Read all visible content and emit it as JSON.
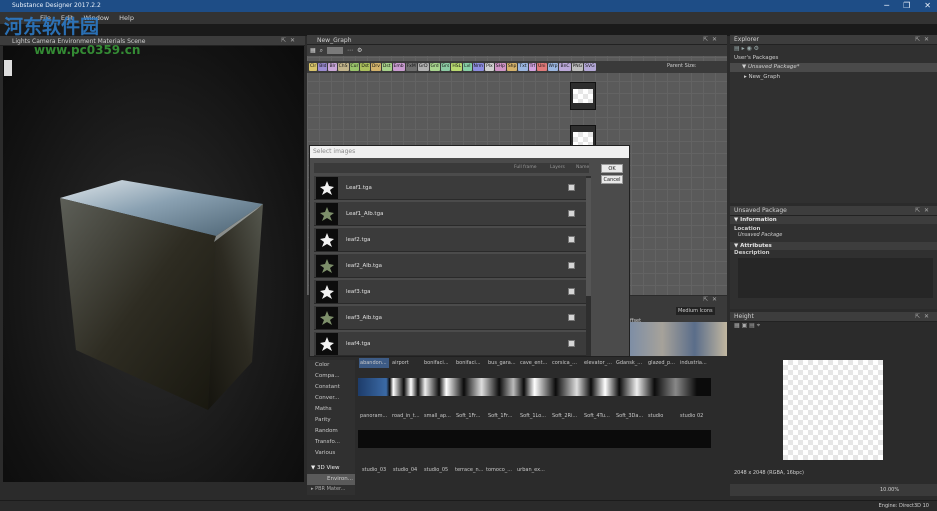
{
  "window": {
    "title": "Substance Designer 2017.2.2",
    "min": "─",
    "max": "❐",
    "close": "✕"
  },
  "menu": [
    "File",
    "Edit",
    "Window",
    "Help"
  ],
  "viewport": {
    "header": "Lights  Camera  Environment  Materials  Scene",
    "tab": "3D View"
  },
  "watermark": {
    "line1": "河东软件园",
    "line2": "www.pc0359.cn"
  },
  "graph": {
    "tab": "New_Graph",
    "parent_size": "Parent Size:",
    "tags": [
      [
        "Clr",
        "#d8c46a"
      ],
      [
        "Bld",
        "#9b8bd1"
      ],
      [
        "Blr",
        "#c9a6d8"
      ],
      [
        "ChS",
        "#c2b48a"
      ],
      [
        "Cur",
        "#99c46a"
      ],
      [
        "Dst",
        "#aabf5c"
      ],
      [
        "Drv",
        "#d2b26a"
      ],
      [
        "Dst",
        "#a6d08a"
      ],
      [
        "Emb",
        "#c99bd0"
      ],
      [
        "FxM",
        "#6f6f6f"
      ],
      [
        "GrD",
        "#b1b1b1"
      ],
      [
        "Grd",
        "#a8d48e"
      ],
      [
        "Grs",
        "#8bc9a3"
      ],
      [
        "HSL",
        "#b8d86f"
      ],
      [
        "Lvl",
        "#86cfa5"
      ],
      [
        "Nrm",
        "#8d8de0"
      ],
      [
        "Plx",
        "#cfcfcf"
      ],
      [
        "SHp",
        "#d095c6"
      ],
      [
        "Shp",
        "#d4b26a"
      ],
      [
        "Txt",
        "#9bb6e0"
      ],
      [
        "Trf",
        "#d1a2e0"
      ],
      [
        "Uni",
        "#e07a7a"
      ],
      [
        "Wrp",
        "#9bb6e0"
      ],
      [
        "BnC",
        "#bba8d8"
      ],
      [
        "PNG",
        "#bdbdbd"
      ],
      [
        "SVG",
        "#b3a7d6"
      ]
    ]
  },
  "dialog": {
    "title": "Select images",
    "filter_label": "Full frame",
    "layers_label": "Layers",
    "name_label": "Name",
    "ok": "OK",
    "cancel": "Cancel",
    "files": [
      "Leaf1.tga",
      "Leaf1_Alb.tga",
      "leaf2.tga",
      "leaf2_Alb.tga",
      "leaf3.tga",
      "leaf3_Alb.tga",
      "leaf4.tga"
    ]
  },
  "library": {
    "view_mode": "Medium Icons",
    "tree": [
      "Color",
      "Compa...",
      "Constant",
      "Conver...",
      "Maths",
      "Parity",
      "Random",
      "Transfo...",
      "Various"
    ],
    "tree_header": "3D View",
    "tree_selected": "Environ...",
    "tree_footer": "PBR Mater...",
    "row1": [
      "abandon...",
      "airport",
      "bonifaci...",
      "bonifaci...",
      "bus_gara...",
      "cave_ent...",
      "corsica_...",
      "elevator_...",
      "Gdansk_...",
      "glazed_p...",
      "industria..."
    ],
    "row2": [
      "panoram...",
      "road_in_t...",
      "small_ap...",
      "Soft_1Fr...",
      "Soft_1Fr...",
      "Soft_1Lo...",
      "Soft_2Ri...",
      "Soft_4Tu...",
      "Soft_3Da...",
      "studio",
      "studio 02"
    ],
    "row3": [
      "studio_03",
      "studio_04",
      "studio_05",
      "terrace_n...",
      "tomoco_...",
      "urban_ex..."
    ],
    "filter": "ffset"
  },
  "explorer": {
    "tab": "Explorer",
    "root": "User's Packages",
    "package": "Unsaved Package*",
    "graph": "New_Graph"
  },
  "props": {
    "tab": "Unsaved Package",
    "sec1": "Information",
    "location_label": "Location",
    "location": "Unsaved Package",
    "sec2": "Attributes",
    "description": "Description"
  },
  "height": {
    "tab": "Height",
    "info": "2048 x 2048 (RGBA, 16bpc)",
    "zoom": "10.00%"
  },
  "status": {
    "engine": "Engine: Direct3D 10"
  }
}
